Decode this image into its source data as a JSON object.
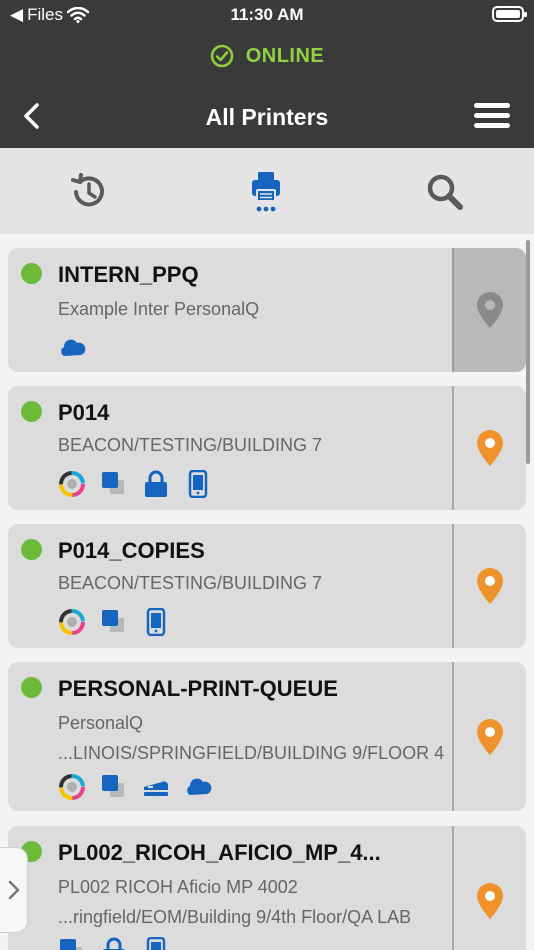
{
  "status_bar": {
    "carrier": "Files",
    "time": "11:30 AM"
  },
  "header": {
    "connection_status": "ONLINE",
    "title": "All Printers"
  },
  "tabs": [
    "history-icon",
    "printer-icon",
    "search-icon"
  ],
  "colors": {
    "online_green": "#6cba3a",
    "accent_blue": "#1565c0",
    "pin_orange": "#f0922b",
    "header_bg": "#3a3a3a"
  },
  "printers": [
    {
      "name": "INTERN_PPQ",
      "line1": "Example Inter PersonalQ",
      "line2": "",
      "icons": [
        "cloud-icon"
      ],
      "location_enabled": false
    },
    {
      "name": "P014",
      "line1": "BEACON/TESTING/BUILDING 7",
      "line2": "",
      "icons": [
        "color-wheel-icon",
        "copy-pages-icon",
        "lock-icon",
        "mobile-icon"
      ],
      "location_enabled": true
    },
    {
      "name": "P014_COPIES",
      "line1": "BEACON/TESTING/BUILDING 7",
      "line2": "",
      "icons": [
        "color-wheel-icon",
        "copy-pages-icon",
        "mobile-icon"
      ],
      "location_enabled": true
    },
    {
      "name": "PERSONAL-PRINT-QUEUE",
      "line1": "PersonalQ",
      "line2": "...LINOIS/SPRINGFIELD/BUILDING 9/FLOOR 4",
      "icons": [
        "color-wheel-icon",
        "copy-pages-icon",
        "stapler-icon",
        "cloud-icon"
      ],
      "location_enabled": true
    },
    {
      "name": "PL002_RICOH_AFICIO_MP_4...",
      "line1": "PL002 RICOH Aficio MP 4002",
      "line2": "...ringfield/EOM/Building 9/4th Floor/QA LAB",
      "icons": [
        "copy-pages-icon",
        "lock-icon",
        "mobile-icon"
      ],
      "location_enabled": true
    }
  ]
}
